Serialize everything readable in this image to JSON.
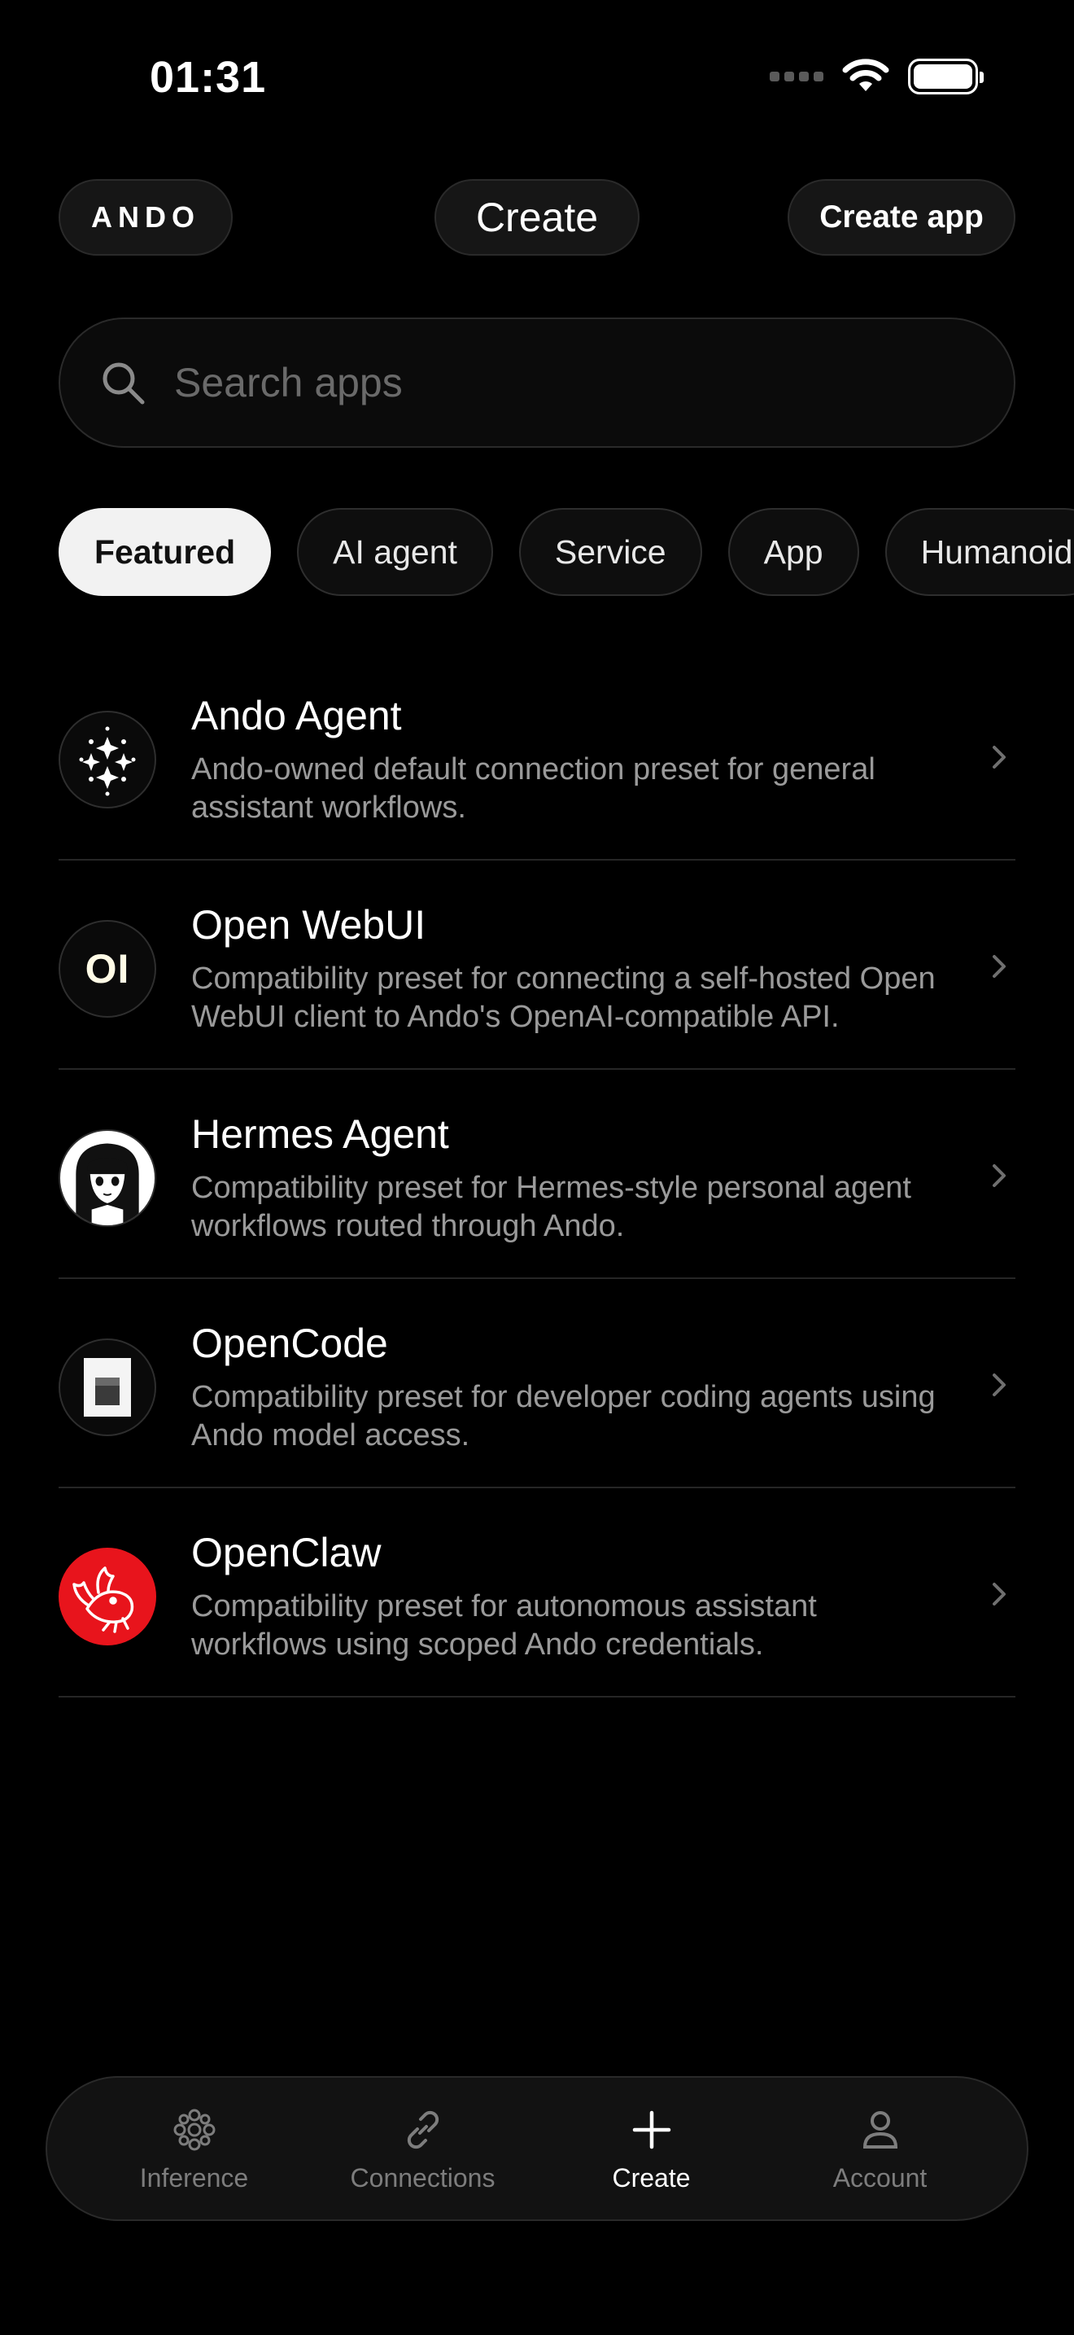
{
  "status_bar": {
    "time": "01:31"
  },
  "header": {
    "brand": "ANDO",
    "title": "Create",
    "create_app_label": "Create app"
  },
  "search": {
    "placeholder": "Search apps",
    "value": ""
  },
  "filters": [
    {
      "label": "Featured",
      "active": true
    },
    {
      "label": "AI agent",
      "active": false
    },
    {
      "label": "Service",
      "active": false
    },
    {
      "label": "App",
      "active": false
    },
    {
      "label": "Humanoid",
      "active": false
    }
  ],
  "apps": [
    {
      "name": "Ando Agent",
      "description": "Ando-owned default connection preset for general assistant workflows.",
      "icon": "sparkle-grid-icon"
    },
    {
      "name": "Open WebUI",
      "description": "Compatibility preset for connecting a self-hosted Open WebUI client to Ando's OpenAI-compatible API.",
      "icon": "oi-logo-icon",
      "icon_text": "OI"
    },
    {
      "name": "Hermes Agent",
      "description": "Compatibility preset for Hermes-style personal agent workflows routed through Ando.",
      "icon": "anime-portrait-icon"
    },
    {
      "name": "OpenCode",
      "description": "Compatibility preset for developer coding agents using Ando model access.",
      "icon": "opencode-logo-icon"
    },
    {
      "name": "OpenClaw",
      "description": "Compatibility preset for autonomous assistant workflows using scoped Ando credentials.",
      "icon": "lobster-icon",
      "icon_color": "#e8141c"
    }
  ],
  "tabbar": [
    {
      "label": "Inference",
      "icon": "flower-dots-icon",
      "active": false
    },
    {
      "label": "Connections",
      "icon": "link-icon",
      "active": false
    },
    {
      "label": "Create",
      "icon": "plus-icon",
      "active": true
    },
    {
      "label": "Account",
      "icon": "person-icon",
      "active": false
    }
  ]
}
